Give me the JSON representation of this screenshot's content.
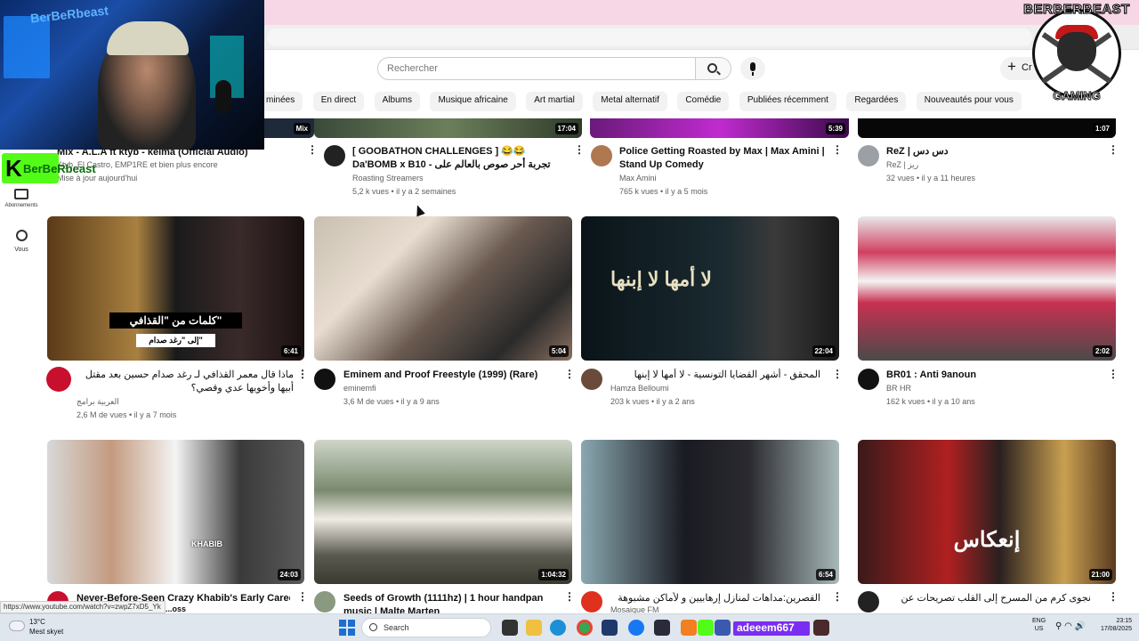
{
  "search": {
    "placeholder": "Rechercher"
  },
  "header": {
    "create_label": "Cr"
  },
  "sidebar": {
    "subs_label": "Abonnements",
    "you_label": "Vous"
  },
  "chips": [
    "Émissions terminées",
    "En direct",
    "Albums",
    "Musique africaine",
    "Art martial",
    "Metal alternatif",
    "Comédie",
    "Publiées récemment",
    "Regardées",
    "Nouveautés pour vous"
  ],
  "chip_first_visible": "minées",
  "row1": [
    {
      "title": "Mix - A.L.A ft ktyb - kelma (Official Audio)",
      "channel": "Ktyb, El Castro, EMP1RE et bien plus encore",
      "meta": "Mise à jour aujourd'hui",
      "badge": "Mix"
    },
    {
      "title": "[ GOOBATHON CHALLENGES ] 😂😂 Da'BOMB x B10 - تجربة أحر صوص بالعالم على الشباب | Gooba",
      "channel": "Roasting Streamers",
      "meta": "5,2 k vues • il y a 2 semaines",
      "duration": "17:04"
    },
    {
      "title": "Police Getting Roasted by Max | Max Amini | Stand Up Comedy",
      "channel": "Max Amini",
      "meta": "765 k vues • il y a 5 mois",
      "duration": "5:39"
    },
    {
      "title": "ReZ | دس دس",
      "channel": "ReZ | ريز",
      "meta": "32 vues • il y a 11 heures",
      "duration": "1:07"
    }
  ],
  "row2": [
    {
      "title": "ماذا قال معمر القذافي لـ رغد صدام حسين بعد مقتل أبيها وأخويها عدي وقصي؟",
      "channel": "العربية برامج",
      "meta": "2,6 M de vues • il y a 7 mois",
      "duration": "6:41",
      "overlay": "كلمات من \"القذافي\"",
      "overlay2": "إلى \"رغد صدام\""
    },
    {
      "title": "Eminem and Proof Freestyle (1999) (Rare)",
      "channel": "eminemfi",
      "meta": "3,6 M de vues • il y a 9 ans",
      "duration": "5:04"
    },
    {
      "title": "المحقق - أشهر القضايا التونسية - لا أمها لا إبنها",
      "channel": "Hamza Belloumi",
      "meta": "203 k vues • il y a 2 ans",
      "duration": "22:04",
      "overlay": "لا أمها لا إبنها"
    },
    {
      "title": "BR01 : Anti 9anoun",
      "channel": "BR HR",
      "meta": "162 k vues • il y a 10 ans",
      "duration": "2:02"
    }
  ],
  "row3": [
    {
      "title": "Never-Before-Seen Crazy Khabib's Early Career",
      "title2": "...oss",
      "duration": "24:03",
      "overlay": "KHABIB"
    },
    {
      "title": "Seeds of Growth (1111hz) | 1 hour handpan music | Malte Marten",
      "duration": "1:04:32"
    },
    {
      "title": "القصرين:مداهات لمنازل إرهابيين و لأماكن مشبوهة بجبل السلوم",
      "channel": "Mosaique FM",
      "duration": "6:54"
    },
    {
      "title": "نجوى كرم من المسرح إلى القلب تصريحات عن الفن والحياة",
      "duration": "21:00",
      "overlay": "إنعكاس"
    }
  ],
  "streamer": {
    "name": "BerBeRbeast",
    "kick": "BerBeRbeast"
  },
  "brand": {
    "top": "BERBERBEAST",
    "bottom": "GAMING"
  },
  "status_url": "https://www.youtube.com/watch?v=zwpZ7xD5_Yk",
  "taskbar": {
    "temp": "13°C",
    "weather": "Mest skyet",
    "search": "Search",
    "stream_label": "adeeem667",
    "lang1": "ENG",
    "lang2": "US",
    "time": "23:15",
    "date": "17/08/2025"
  },
  "colors": {
    "accent_pink": "#f7d6e6",
    "kick_green": "#53fc18",
    "yt_red": "#ff0000"
  }
}
